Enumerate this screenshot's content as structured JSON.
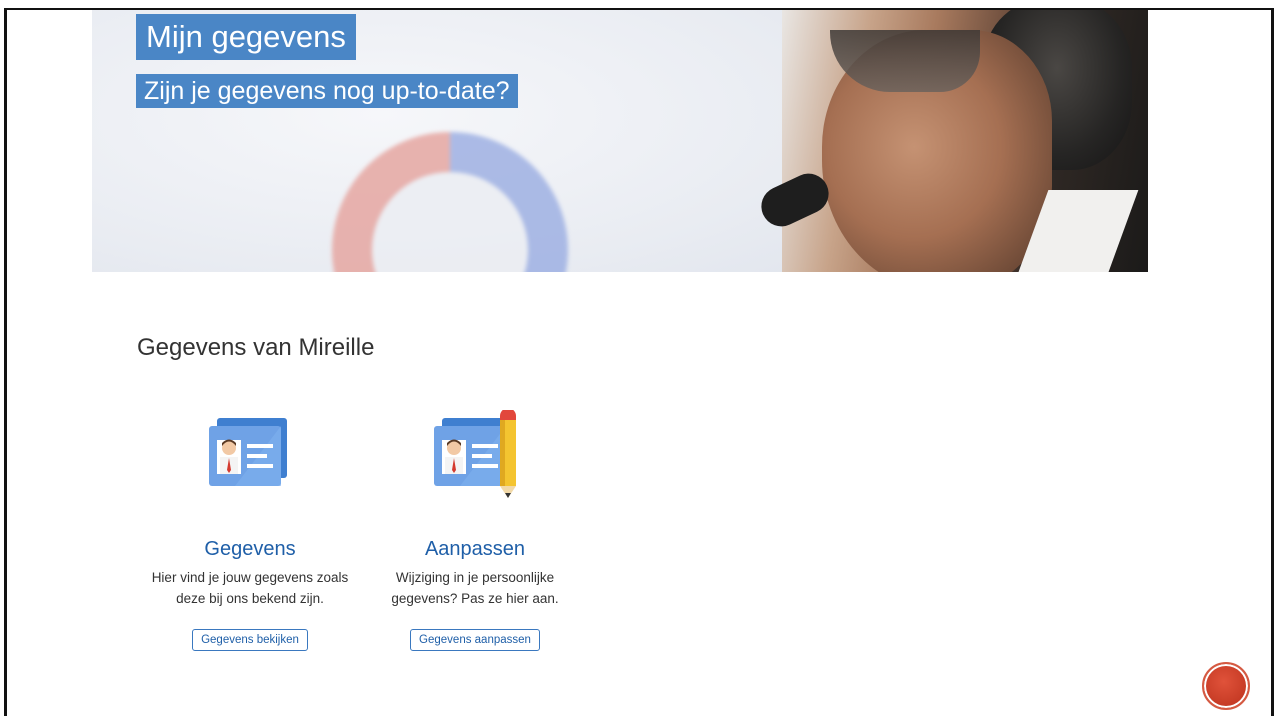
{
  "hero": {
    "title": "Mijn gegevens",
    "subtitle": "Zijn je gegevens nog up-to-date?"
  },
  "section": {
    "title": "Gegevens van Mireille"
  },
  "cards": [
    {
      "icon": "id-card-icon",
      "title": "Gegevens",
      "description_line1": "Hier vind je jouw gegevens zoals",
      "description_line2": "deze bij ons bekend zijn.",
      "button_label": "Gegevens bekijken"
    },
    {
      "icon": "id-card-edit-icon",
      "title": "Aanpassen",
      "description_line1": "Wijziging in je persoonlijke",
      "description_line2": "gegevens? Pas ze hier aan.",
      "button_label": "Gegevens aanpassen"
    }
  ],
  "colors": {
    "accent": "#4a86c6",
    "link": "#1f5fa8",
    "corner_button": "#c53a24"
  }
}
